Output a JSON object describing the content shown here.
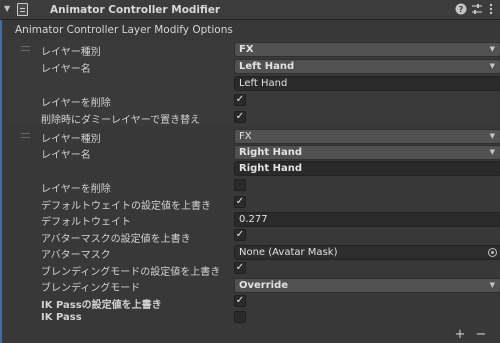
{
  "header": {
    "title": "Animator Controller Modifier",
    "collapse_icon": "triangle-down-icon",
    "component_icon": "script-file-icon",
    "help_icon": "help-icon",
    "preset_icon": "sliders-icon",
    "menu_icon": "kebab-menu-icon"
  },
  "section_title": "Animator Controller Layer Modify Options",
  "layers": [
    {
      "layer_type_label": "レイヤー種別",
      "layer_type_value": "FX",
      "layer_name_label": "レイヤー名",
      "layer_name_value": "Left Hand",
      "layer_name_text": "Left Hand",
      "delete_label": "レイヤーを削除",
      "delete_checked": true,
      "replace_dummy_label": "削除時にダミーレイヤーで置き替え",
      "replace_dummy_checked": true
    },
    {
      "layer_type_label": "レイヤー種別",
      "layer_type_value": "FX",
      "layer_name_label": "レイヤー名",
      "layer_name_value": "Right Hand",
      "layer_name_text": "Right Hand",
      "delete_label": "レイヤーを削除",
      "delete_checked": false,
      "override_weight_label": "デフォルトウェイトの設定値を上書き",
      "override_weight_checked": true,
      "weight_label": "デフォルトウェイト",
      "weight_value": "0.277",
      "override_mask_label": "アバターマスクの設定値を上書き",
      "override_mask_checked": true,
      "mask_label": "アバターマスク",
      "mask_value": "None (Avatar Mask)",
      "override_blend_label": "ブレンディングモードの設定値を上書き",
      "override_blend_checked": true,
      "blend_label": "ブレンディングモード",
      "blend_value": "Override",
      "override_ik_label": "IK Passの設定値を上書き",
      "override_ik_checked": true,
      "ik_label": "IK Pass",
      "ik_checked": false
    }
  ],
  "footer": {
    "add_label": "+",
    "remove_label": "−"
  },
  "glyphs": {
    "check": "✓",
    "caret": "▼",
    "collapse": "▼"
  },
  "colors": {
    "background": "#383838",
    "accent_bar": "#3f6fa8",
    "dropdown_bg": "#515151",
    "field_bg": "#2a2a2a"
  }
}
